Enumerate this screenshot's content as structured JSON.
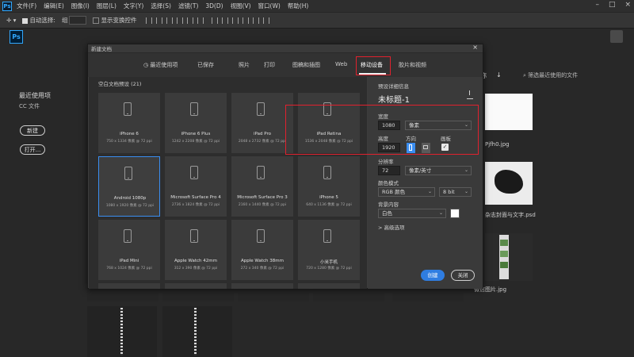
{
  "app": {
    "logo": "Ps",
    "menu": [
      "文件(F)",
      "编辑(E)",
      "图像(I)",
      "图层(L)",
      "文字(Y)",
      "选择(S)",
      "滤镜(T)",
      "3D(D)",
      "视图(V)",
      "窗口(W)",
      "帮助(H)"
    ],
    "window_controls": [
      "–",
      "□",
      "×"
    ]
  },
  "options_bar": {
    "auto_select_label": "自动选择:",
    "layer_value": "组",
    "transform_label": "显示变换控件"
  },
  "home": {
    "recent_label": "最近使用项",
    "cc_files": "CC 文件",
    "new_button": "新建",
    "open_button": "打开...",
    "sort_label": "名称",
    "search_placeholder": "筛选最近使用的文件",
    "file_labels": [
      "Pjfh0.jpg",
      "杂志封面与文字.psd",
      "微信图片.jpg"
    ]
  },
  "dialog": {
    "title": "新建文档",
    "close": "×",
    "tabs": [
      {
        "label": "最近使用项",
        "active": false
      },
      {
        "label": "已保存",
        "active": false
      },
      {
        "label": "照片",
        "active": false
      },
      {
        "label": "打印",
        "active": false
      },
      {
        "label": "图稿和插图",
        "active": false
      },
      {
        "label": "Web",
        "active": false
      },
      {
        "label": "移动设备",
        "active": true
      },
      {
        "label": "胶片和视频",
        "active": false
      }
    ],
    "section_title": "空白文档预设 (21)",
    "presets": [
      {
        "name": "iPhone 6",
        "size": "750 x 1334 像素 @ 72 ppi"
      },
      {
        "name": "iPhone 6 Plus",
        "size": "1242 x 2208 像素 @ 72 ppi"
      },
      {
        "name": "iPad Pro",
        "size": "2048 x 2732 像素 @ 72 ppi"
      },
      {
        "name": "iPad Retina",
        "size": "1536 x 2048 像素 @ 72 ppi"
      },
      {
        "name": "Android 1080p",
        "size": "1080 x 1920 像素 @ 72 ppi"
      },
      {
        "name": "Microsoft Surface Pro 4",
        "size": "2736 x 1824 像素 @ 72 ppi"
      },
      {
        "name": "Microsoft Surface Pro 3",
        "size": "2160 x 1440 像素 @ 72 ppi"
      },
      {
        "name": "iPhone 5",
        "size": "640 x 1136 像素 @ 72 ppi"
      },
      {
        "name": "iPad Mini",
        "size": "768 x 1024 像素 @ 72 ppi"
      },
      {
        "name": "Apple Watch 42mm",
        "size": "312 x 390 像素 @ 72 ppi"
      },
      {
        "name": "Apple Watch 38mm",
        "size": "272 x 340 像素 @ 72 ppi"
      },
      {
        "name": "小米手机",
        "size": "720 x 1280 像素 @ 72 ppi"
      }
    ],
    "details": {
      "header": "预设详细信息",
      "doc_title": "未标题-1",
      "width_label": "宽度",
      "width_value": "1080",
      "unit_value": "像素",
      "height_label": "高度",
      "height_value": "1920",
      "orientation_label": "方向",
      "artboard_label": "画板",
      "resolution_label": "分辨率",
      "resolution_value": "72",
      "resolution_unit": "像素/英寸",
      "color_mode_label": "颜色模式",
      "color_mode_value": "RGB 颜色",
      "bit_depth_value": "8 bit",
      "bg_label": "背景内容",
      "bg_value": "白色",
      "advanced_label": "> 高级选项",
      "create_button": "创建",
      "close_button": "关闭"
    }
  }
}
